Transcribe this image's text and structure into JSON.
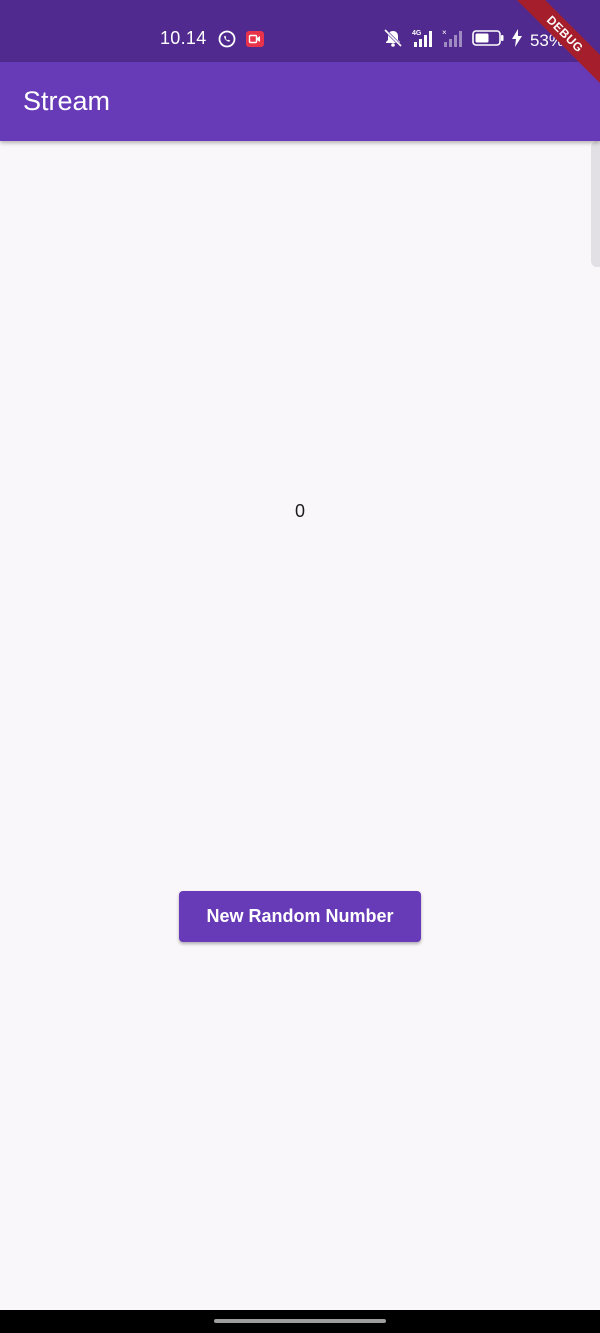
{
  "status_bar": {
    "time": "10.14",
    "battery": "53%",
    "icons_left": [
      "whatsapp-icon",
      "screen-record-icon"
    ],
    "icons_right": [
      "mute-icon",
      "signal-4g-icon",
      "signal-no-service-icon",
      "battery-icon",
      "charging-icon"
    ]
  },
  "app_bar": {
    "title": "Stream"
  },
  "main": {
    "counter_value": "0",
    "button_label": "New Random Number"
  },
  "debug_banner": {
    "label": "DEBUG"
  },
  "colors": {
    "status_bar": "#512a8f",
    "primary": "#673ab7",
    "background": "#f9f7fa",
    "debug": "#a51e2b"
  }
}
